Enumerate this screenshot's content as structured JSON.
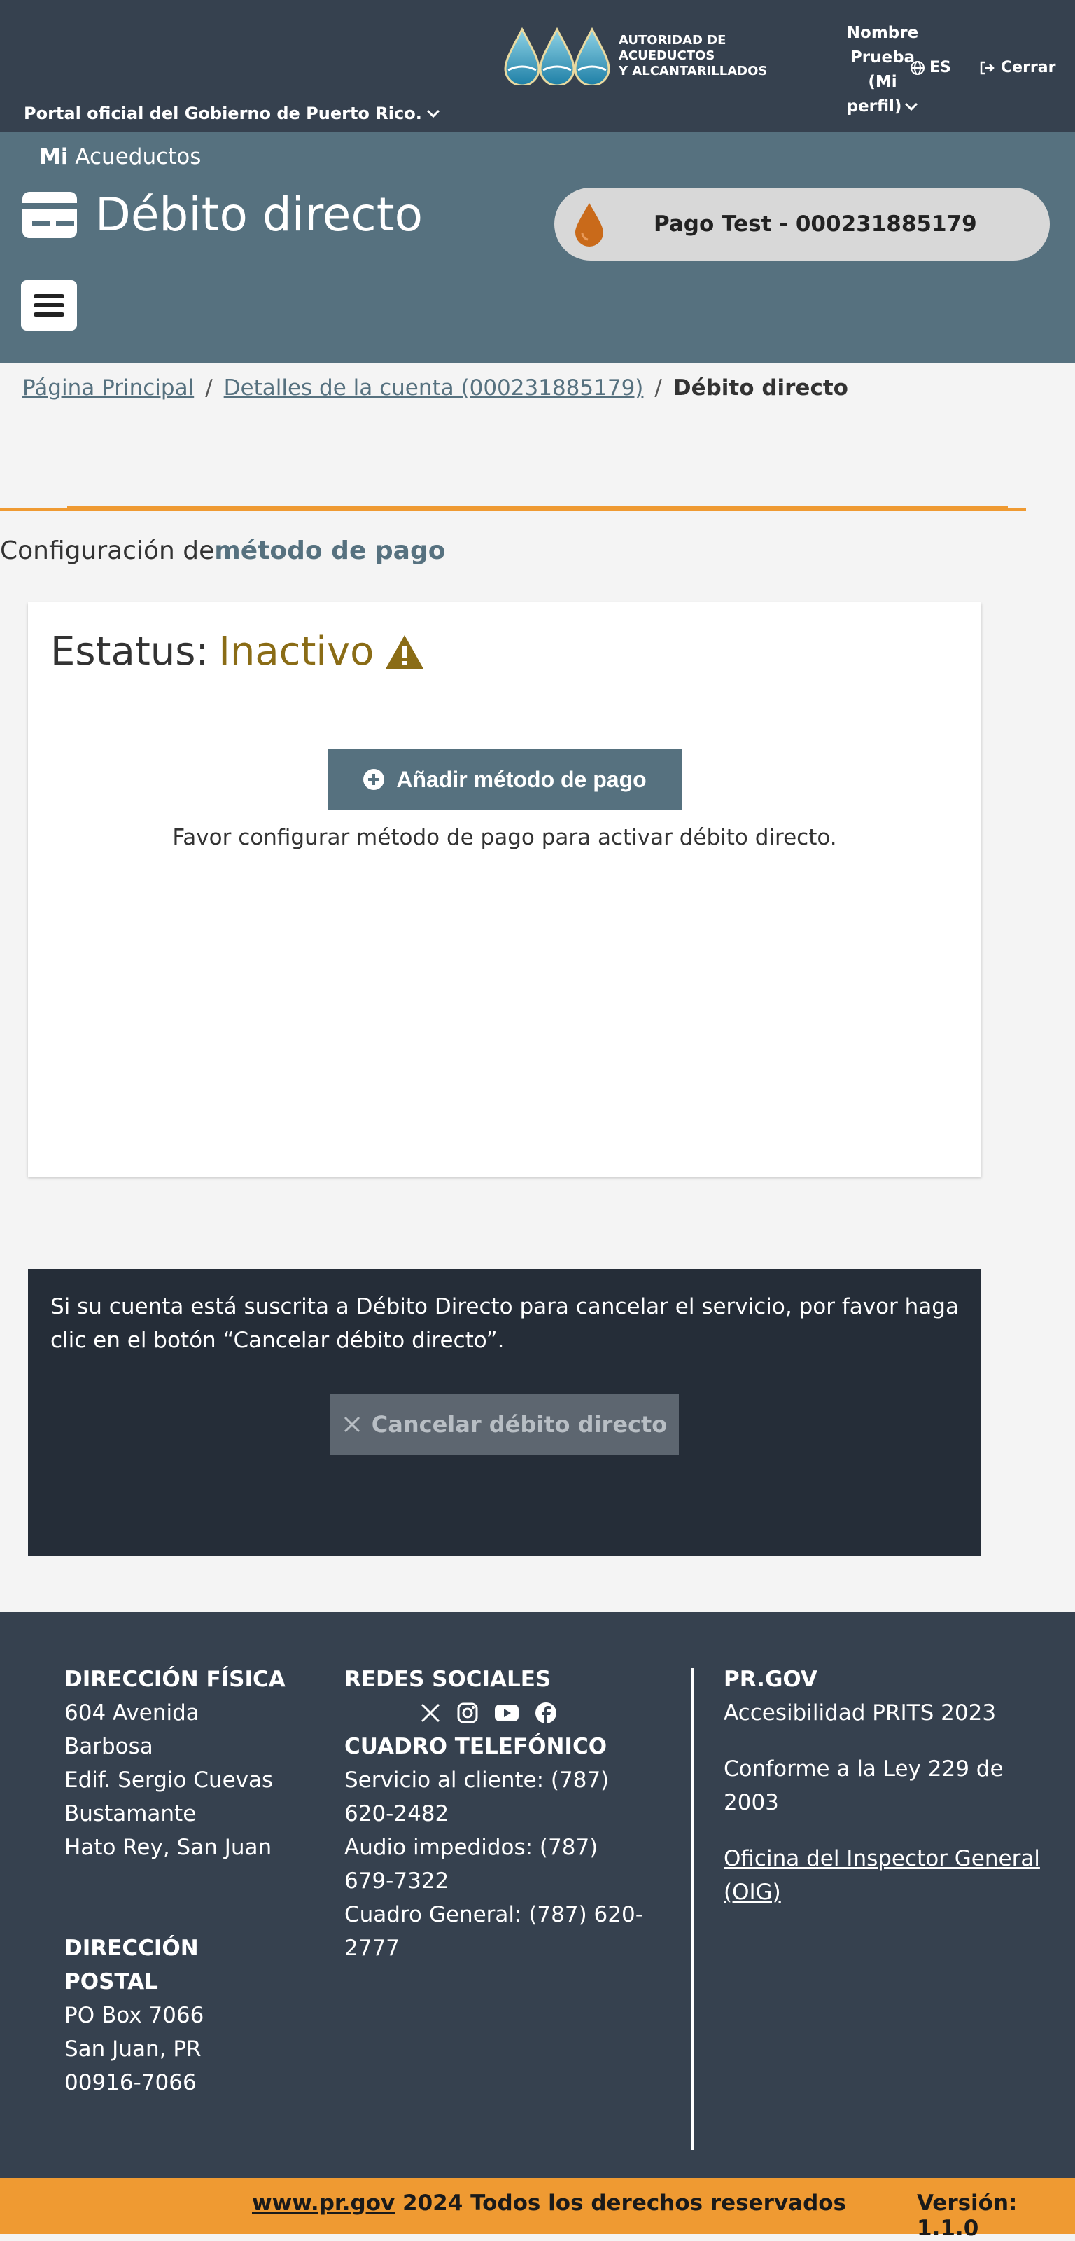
{
  "topbar": {
    "portal_label": "Portal oficial del Gobierno de Puerto Rico.",
    "logo_text_line1": "AUTORIDAD DE ACUEDUCTOS",
    "logo_text_line2": "Y ALCANTARILLADOS",
    "profile_line1": "Nombre",
    "profile_line2": "Prueba",
    "profile_line3": "(Mi",
    "profile_line4": "perfil)",
    "language": "ES",
    "logout": "Cerrar"
  },
  "hero": {
    "brand_bold": "Mi",
    "brand_rest": "Acueductos",
    "title": "Débito directo",
    "account": "Pago Test - 000231885179"
  },
  "breadcrumb": {
    "home": "Página Principal",
    "account": "Detalles de la cuenta (000231885179)",
    "current": "Débito directo",
    "separator": "/"
  },
  "section": {
    "title_prefix": "Configuración de",
    "title_bold": "método de pago"
  },
  "status": {
    "label": "Estatus:",
    "value": "Inactivo",
    "add_button": "Añadir método de pago",
    "help": "Favor configurar método de pago para activar débito directo."
  },
  "cancel": {
    "text": "Si su cuenta está suscrita a Débito Directo para cancelar el servicio, por favor haga clic en el botón “Cancelar débito directo”.",
    "button": "Cancelar débito directo"
  },
  "footer": {
    "physical_heading": "DIRECCIÓN FÍSICA",
    "physical_lines": [
      "604 Avenida",
      "Barbosa",
      "Edif. Sergio Cuevas",
      "Bustamante",
      "Hato Rey, San Juan"
    ],
    "postal_heading_1": "DIRECCIÓN",
    "postal_heading_2": "POSTAL",
    "postal_lines": [
      "PO Box 7066",
      "San Juan, PR",
      "00916-7066"
    ],
    "social_heading": "REDES SOCIALES",
    "phone_heading": "CUADRO TELEFÓNICO",
    "phone_lines": [
      "Servicio al cliente: (787)",
      "620-2482",
      "Audio impedidos: (787)",
      "679-7322",
      "Cuadro General: (787) 620-",
      "2777"
    ],
    "prgov_heading": "PR.GOV",
    "accessibility": "Accesibilidad PRITS 2023",
    "law": "Conforme a la Ley 229 de 2003",
    "oig": "Oficina del Inspector General (OIG)"
  },
  "bottom": {
    "site": "www.pr.gov",
    "rights": "2024 Todos los derechos reservados",
    "version": "Versión: 1.1.0"
  },
  "icons": {
    "social": [
      "x-icon",
      "instagram-icon",
      "youtube-icon",
      "facebook-icon"
    ]
  },
  "colors": {
    "header": "#36414f",
    "hero": "#56717f",
    "accent_orange": "#ef9a32",
    "status_inactive": "#8a6c16",
    "cancel_panel": "#252d38"
  }
}
